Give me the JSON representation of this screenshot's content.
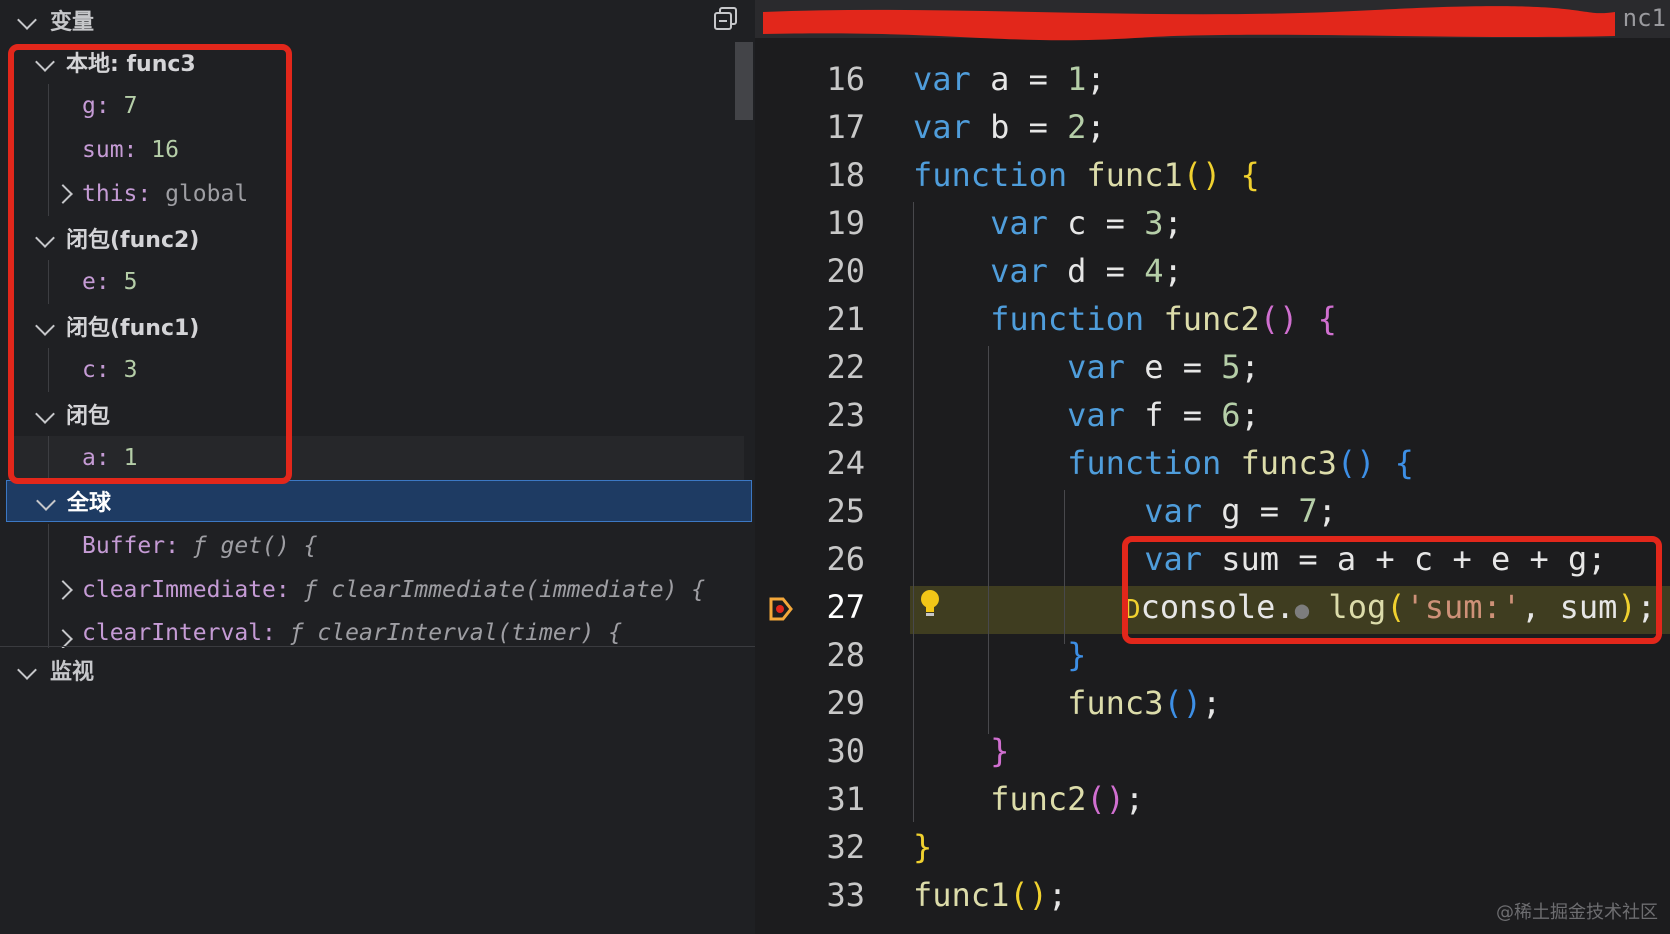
{
  "variables_panel": {
    "title": "变量",
    "local_scope": {
      "label": "本地: func3",
      "items": [
        {
          "key": "g",
          "value": "7"
        },
        {
          "key": "sum",
          "value": "16"
        },
        {
          "key": "this",
          "value": "global"
        }
      ]
    },
    "closure_func2": {
      "label": "闭包(func2)",
      "items": [
        {
          "key": "e",
          "value": "5"
        }
      ]
    },
    "closure_func1": {
      "label": "闭包(func1)",
      "items": [
        {
          "key": "c",
          "value": "3"
        }
      ]
    },
    "closure": {
      "label": "闭包",
      "items": [
        {
          "key": "a",
          "value": "1"
        }
      ]
    },
    "global_scope": {
      "label": "全球",
      "items": [
        {
          "key": "Buffer",
          "value": "ƒ get() {"
        },
        {
          "key": "clearImmediate",
          "value": "ƒ clearImmediate(immediate) {"
        },
        {
          "key": "clearInterval",
          "value": "ƒ clearInterval(timer) {"
        }
      ]
    }
  },
  "watch_panel": {
    "title": "监视"
  },
  "editor": {
    "tab_label_partial": "nc1",
    "current_line": 27,
    "lines": [
      {
        "num": "16"
      },
      {
        "num": "17"
      },
      {
        "num": "18"
      },
      {
        "num": "19"
      },
      {
        "num": "20"
      },
      {
        "num": "21"
      },
      {
        "num": "22"
      },
      {
        "num": "23"
      },
      {
        "num": "24"
      },
      {
        "num": "25"
      },
      {
        "num": "26"
      },
      {
        "num": "27"
      },
      {
        "num": "28"
      },
      {
        "num": "29"
      },
      {
        "num": "30"
      },
      {
        "num": "31"
      },
      {
        "num": "32"
      },
      {
        "num": "33"
      }
    ]
  },
  "watermark": "@稀土掘金技术社区",
  "colors": {
    "annotation_red": "#e2271b",
    "selection_blue": "#1e3b63",
    "current_line_bg": "#3f3d20"
  }
}
